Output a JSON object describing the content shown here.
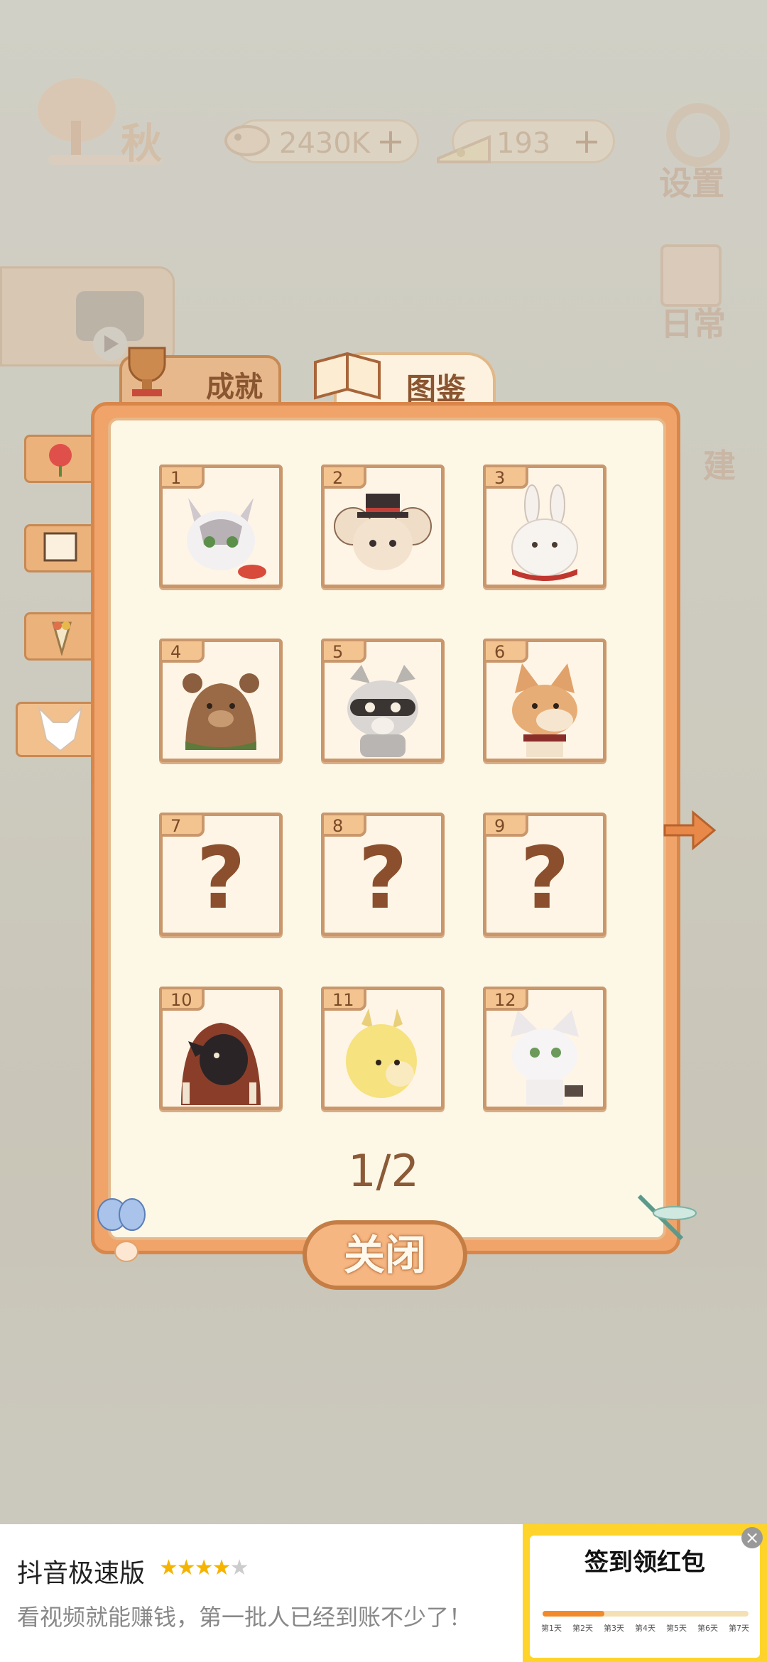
{
  "hud": {
    "season": "秋",
    "fish_amount": "2430K",
    "cheese_amount": "193",
    "settings_label": "设置",
    "daily_label": "日常",
    "build_label": "建"
  },
  "tabs": {
    "achievements": "成就",
    "atlas": "图鉴"
  },
  "atlas": {
    "cards": [
      {
        "num": "1",
        "icon": "white-cat-icon",
        "locked": false
      },
      {
        "num": "2",
        "icon": "mouse-with-hat-icon",
        "locked": false
      },
      {
        "num": "3",
        "icon": "white-rabbit-icon",
        "locked": false
      },
      {
        "num": "4",
        "icon": "brown-bear-icon",
        "locked": false
      },
      {
        "num": "5",
        "icon": "raccoon-icon",
        "locked": false
      },
      {
        "num": "6",
        "icon": "shiba-dog-icon",
        "locked": false
      },
      {
        "num": "7",
        "icon": "question-mark",
        "locked": true,
        "label": "?"
      },
      {
        "num": "8",
        "icon": "question-mark",
        "locked": true,
        "label": "?"
      },
      {
        "num": "9",
        "icon": "question-mark",
        "locked": true,
        "label": "?"
      },
      {
        "num": "10",
        "icon": "hooded-crow-icon",
        "locked": false
      },
      {
        "num": "11",
        "icon": "alpaca-icon",
        "locked": false
      },
      {
        "num": "12",
        "icon": "white-fox-icon",
        "locked": false
      }
    ],
    "page": "1/2"
  },
  "close_label": "关闭",
  "ad": {
    "title": "抖音极速版",
    "rating": 4,
    "subtitle": "看视频就能赚钱，第一批人已经到账不少了！",
    "card_title": "签到领红包",
    "progress": 0.3,
    "days": [
      "第1天",
      "第2天",
      "第3天",
      "第4天",
      "第5天",
      "第6天",
      "第7天"
    ]
  },
  "colors": {
    "panel_orange": "#f0a46a",
    "panel_inner": "#fdf7e6",
    "card_border": "#c9976b",
    "question": "#8b4f2d",
    "ad_yellow": "#ffd42a"
  }
}
